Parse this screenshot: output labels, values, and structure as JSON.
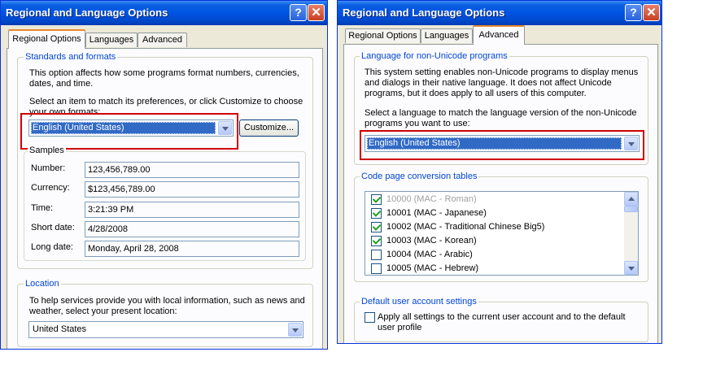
{
  "left_dialog": {
    "title": "Regional and Language Options",
    "help_glyph": "?",
    "close_glyph": "✕",
    "tabs": [
      "Regional Options",
      "Languages",
      "Advanced"
    ],
    "standards": {
      "title": "Standards and formats",
      "desc": "This option affects how some programs format numbers, currencies, dates, and time.",
      "instruction": "Select an item to match its preferences, or click Customize to choose your own formats:",
      "selected": "English (United States)",
      "customize_label": "Customize...",
      "samples_title": "Samples",
      "samples": [
        {
          "label": "Number:",
          "value": "123,456,789.00"
        },
        {
          "label": "Currency:",
          "value": "$123,456,789.00"
        },
        {
          "label": "Time:",
          "value": "3:21:39 PM"
        },
        {
          "label": "Short date:",
          "value": "4/28/2008"
        },
        {
          "label": "Long date:",
          "value": "Monday, April 28, 2008"
        }
      ]
    },
    "location": {
      "title": "Location",
      "desc": "To help services provide you with local information, such as news and weather, select your present location:",
      "selected": "United States"
    }
  },
  "right_dialog": {
    "title": "Regional and Language Options",
    "help_glyph": "?",
    "close_glyph": "✕",
    "tabs": [
      "Regional Options",
      "Languages",
      "Advanced"
    ],
    "non_unicode": {
      "title": "Language for non-Unicode programs",
      "desc": "This system setting enables non-Unicode programs to display menus and dialogs in their native language. It does not affect Unicode programs, but it does apply to all users of this computer.",
      "instruction": "Select a language to match the language version of the non-Unicode programs you want to use:",
      "selected": "English (United States)"
    },
    "code_pages": {
      "title": "Code page conversion tables",
      "items": [
        {
          "label": "10000 (MAC - Roman)",
          "checked": true,
          "disabled": true
        },
        {
          "label": "10001 (MAC - Japanese)",
          "checked": true,
          "disabled": false
        },
        {
          "label": "10002 (MAC - Traditional Chinese Big5)",
          "checked": true,
          "disabled": false
        },
        {
          "label": "10003 (MAC - Korean)",
          "checked": true,
          "disabled": false
        },
        {
          "label": "10004 (MAC - Arabic)",
          "checked": false,
          "disabled": false
        },
        {
          "label": "10005 (MAC - Hebrew)",
          "checked": false,
          "disabled": false
        }
      ]
    },
    "default_user": {
      "title": "Default user account settings",
      "checkbox_label": "Apply all settings to the current user account and to the default user profile"
    }
  }
}
